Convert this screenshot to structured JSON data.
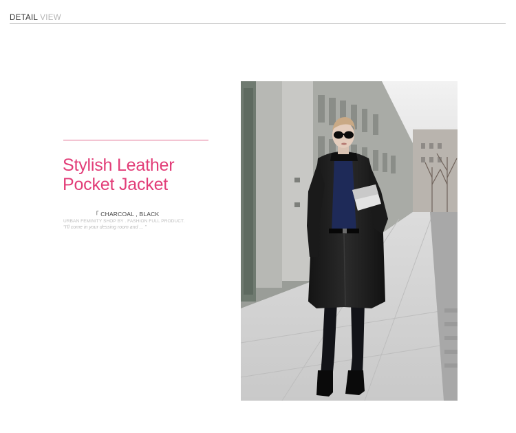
{
  "header": {
    "word1": "DETAIL",
    "word2": "VIEW"
  },
  "product": {
    "title_line1": "Stylish Leather",
    "title_line2": "Pocket Jacket",
    "colors": "「 CHARCOAL , BLACK",
    "shop_line": "URBAN FEMINITY SHOP BY . FASHION FULL PRODUCT.",
    "quote": "\"I'll come in your dessing room and ... \""
  },
  "colors": {
    "accent_pink": "#e23d78",
    "rule_pink": "#e26b8f",
    "header_rule": "#bcbcbc"
  },
  "photo": {
    "subject": "model-in-black-leather-coat-on-city-sidewalk"
  }
}
